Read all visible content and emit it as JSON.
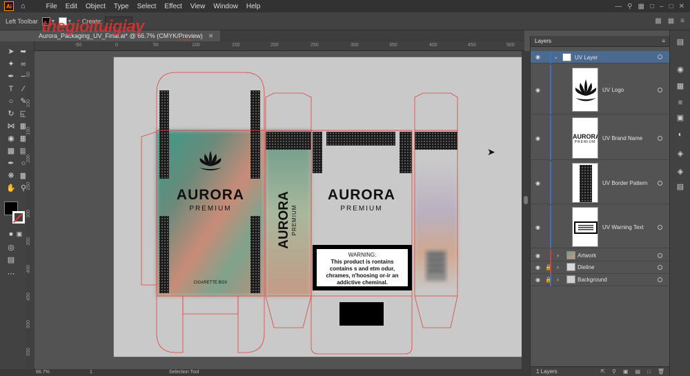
{
  "menubar": {
    "logo": "Ai",
    "items": [
      "File",
      "Edit",
      "Object",
      "Type",
      "Select",
      "Effect",
      "View",
      "Window",
      "Help"
    ]
  },
  "controlbar": {
    "selection_label": "Left Toolbar",
    "create_label": "Create:"
  },
  "doc_tab": {
    "title": "Aurora_Packaging_UV_Final.ai* @ 66.7% (CMYK/Preview)"
  },
  "watermark": {
    "text": "thegioituigiay",
    "sub": ".com"
  },
  "ruler": {
    "h_ticks": [
      "-50",
      "0",
      "50",
      "100",
      "150",
      "200",
      "250",
      "300",
      "350",
      "400",
      "450",
      "500",
      "550",
      "600",
      "650",
      "700"
    ],
    "v_ticks": [
      "50",
      "100",
      "150",
      "200",
      "250",
      "300",
      "350",
      "400",
      "450",
      "500",
      "550"
    ]
  },
  "packaging": {
    "brand": "AURORA",
    "sub_brand": "PREMIUM",
    "front_footer": "CIGARETTE BOX",
    "warning_title": "WARNING:",
    "warning_body_1": "This product is rontains",
    "warning_body_2": "contains s and etm odur,",
    "warning_body_3": "chrames, n'hoosing or-ir an",
    "warning_body_4": "addictive cheminal."
  },
  "statusbar": {
    "zoom": "66.7%",
    "artboard_num": "1",
    "tool": "Selection Tool"
  },
  "layers_panel": {
    "title": "Layers",
    "layers": [
      {
        "name": "UV Layer",
        "expanded": true,
        "selected": true
      },
      {
        "name": "UV Logo",
        "thumb": "lotus-icon"
      },
      {
        "name": "UV Brand Name",
        "thumb_text_1": "AURORA",
        "thumb_text_2": "PREMIUM"
      },
      {
        "name": "UV Border Pattern",
        "thumb": "dot-pattern"
      },
      {
        "name": "UV Warning Text",
        "thumb": "warning-box"
      },
      {
        "name": "Artwork",
        "locked": false
      },
      {
        "name": "Dieline",
        "locked": true
      },
      {
        "name": "Background",
        "locked": true
      }
    ],
    "footer_count": "1 Layers"
  },
  "colors": {
    "accent_red": "#d93535",
    "dieline": "#e0403a",
    "layer_selected": "#4a6a8f",
    "uv_layer_bar": "#3b6fd8",
    "artwork_bar": "#d83c3c"
  }
}
